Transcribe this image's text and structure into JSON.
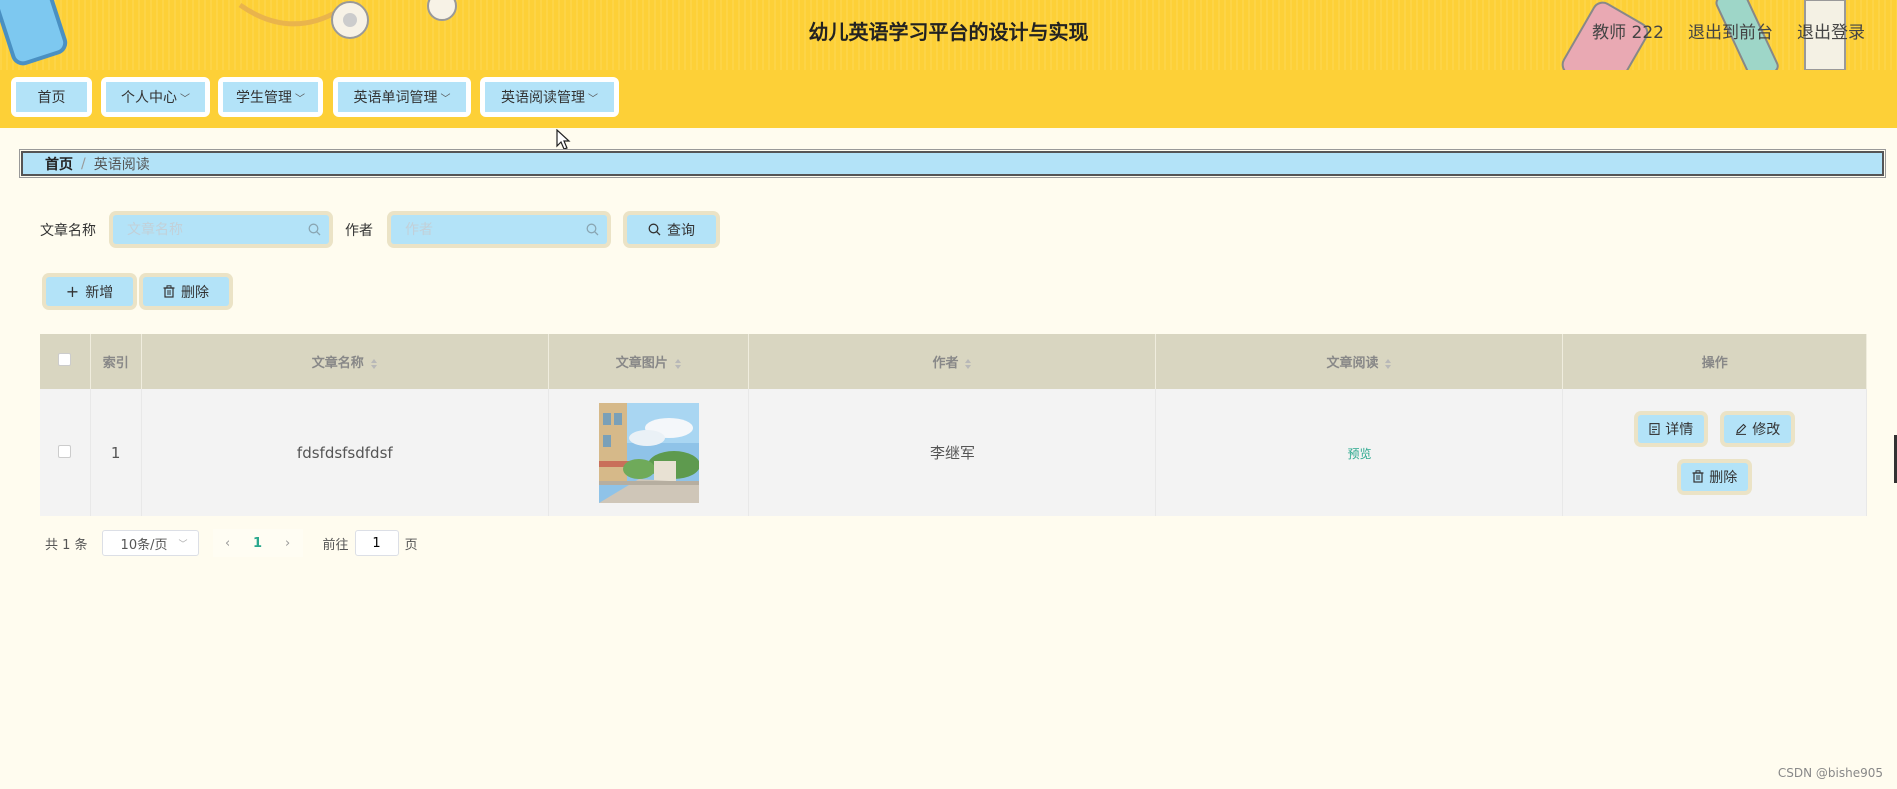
{
  "header": {
    "title": "幼儿英语学习平台的设计与实现",
    "links": [
      "教师 222",
      "退出到前台",
      "退出登录"
    ]
  },
  "nav": {
    "items": [
      {
        "label": "首页",
        "has_dropdown": false
      },
      {
        "label": "个人中心",
        "has_dropdown": true
      },
      {
        "label": "学生管理",
        "has_dropdown": true
      },
      {
        "label": "英语单词管理",
        "has_dropdown": true
      },
      {
        "label": "英语阅读管理",
        "has_dropdown": true
      }
    ]
  },
  "breadcrumb": {
    "home": "首页",
    "separator": "/",
    "current": "英语阅读"
  },
  "search": {
    "title_label": "文章名称",
    "title_placeholder": "文章名称",
    "author_label": "作者",
    "author_placeholder": "作者",
    "query_button": "查询"
  },
  "actions": {
    "add": "新增",
    "delete": "删除"
  },
  "table": {
    "columns": [
      "索引",
      "文章名称",
      "文章图片",
      "作者",
      "文章阅读",
      "操作"
    ],
    "rows": [
      {
        "index": "1",
        "title": "fdsfdsfsdfdsf",
        "author": "李继军",
        "read": "预览",
        "ops": [
          "详情",
          "修改",
          "删除"
        ]
      }
    ]
  },
  "pagination": {
    "total": "共 1 条",
    "page_size": "10条/页",
    "current_page": "1",
    "goto_prefix": "前往",
    "goto_value": "1",
    "goto_suffix": "页"
  },
  "watermark": "CSDN @bishe905",
  "colors": {
    "header_bg": "#fdd037",
    "button_bg": "#b3e3f8",
    "page_bg": "#fffcef",
    "accent_green": "#2aa88e"
  }
}
